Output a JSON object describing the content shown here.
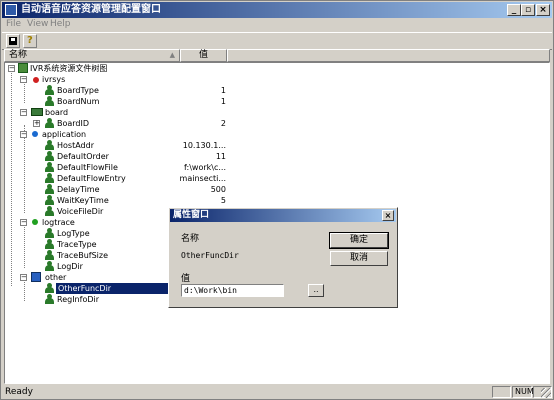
{
  "window": {
    "title": "自动语音应答资源管理配置窗口",
    "min": "_",
    "max": "▫",
    "close": "×"
  },
  "menu": [
    {
      "label": "File"
    },
    {
      "label": "View"
    },
    {
      "label": "Help"
    }
  ],
  "toolbar": {
    "save_icon": "save-icon",
    "help_icon": "?"
  },
  "columns": {
    "name": "名称",
    "value": "值",
    "sort": "▲"
  },
  "tree": {
    "root": "IVR系统资源文件树图",
    "ivrsys": "ivrsys",
    "BoardType": {
      "label": "BoardType",
      "value": "1"
    },
    "BoardNum": {
      "label": "BoardNum",
      "value": "1"
    },
    "board": "board",
    "BoardID": {
      "label": "BoardID",
      "value": "2"
    },
    "application": "application",
    "HostAddr": {
      "label": "HostAddr",
      "value": "10.130.1..."
    },
    "DefaultOrder": {
      "label": "DefaultOrder",
      "value": "11"
    },
    "DefaultFlowFile": {
      "label": "DefaultFlowFile",
      "value": "f:\\work\\c..."
    },
    "DefaultFlowEntry": {
      "label": "DefaultFlowEntry",
      "value": "mainsecti..."
    },
    "DelayTime": {
      "label": "DelayTime",
      "value": "500"
    },
    "WaitKeyTime": {
      "label": "WaitKeyTime",
      "value": "5"
    },
    "VoiceFileDir": {
      "label": "VoiceFileDir",
      "value": ""
    },
    "logtrace": "logtrace",
    "LogType": {
      "label": "LogType",
      "value": ""
    },
    "TraceType": {
      "label": "TraceType",
      "value": ""
    },
    "TraceBufSize": {
      "label": "TraceBufSize",
      "value": ""
    },
    "LogDir": {
      "label": "LogDir",
      "value": ""
    },
    "other": "other",
    "OtherFuncDir": {
      "label": "OtherFuncDir",
      "value": ""
    },
    "RegInfoDir": {
      "label": "RegInfoDir",
      "value": ""
    }
  },
  "status": {
    "text": "Ready",
    "num": "NUM"
  },
  "dialog": {
    "title": "属性窗口",
    "close": "×",
    "name_label": "名称",
    "name_value": "OtherFuncDir",
    "value_label": "值",
    "value_input": "d:\\Work\\bin",
    "ok": "确定",
    "cancel": "取消",
    "browse": ".."
  }
}
